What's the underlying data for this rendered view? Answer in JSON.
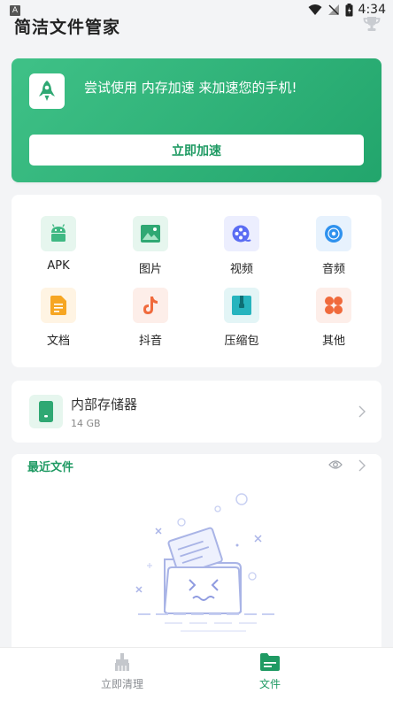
{
  "status_bar": {
    "notification_letter": "A",
    "time": "4:34"
  },
  "header": {
    "title": "简洁文件管家"
  },
  "promo": {
    "message": "尝试使用 内存加速 来加速您的手机!",
    "button_label": "立即加速"
  },
  "categories": [
    {
      "label": "APK",
      "icon": "android-icon",
      "bg": "#e6f6ee"
    },
    {
      "label": "图片",
      "icon": "image-icon",
      "bg": "#e6f6ee"
    },
    {
      "label": "视频",
      "icon": "video-icon",
      "bg": "#eceefe"
    },
    {
      "label": "音频",
      "icon": "audio-icon",
      "bg": "#e7f2fd"
    },
    {
      "label": "文档",
      "icon": "document-icon",
      "bg": "#fff4e3"
    },
    {
      "label": "抖音",
      "icon": "tiktok-icon",
      "bg": "#fdeee9"
    },
    {
      "label": "压缩包",
      "icon": "archive-icon",
      "bg": "#e3f5f6"
    },
    {
      "label": "其他",
      "icon": "other-icon",
      "bg": "#fdeee9"
    }
  ],
  "storage": {
    "name": "内部存储器",
    "size": "14 GB"
  },
  "recent": {
    "title": "最近文件"
  },
  "bottom_nav": [
    {
      "label": "立即清理",
      "icon": "broom-icon",
      "active": false
    },
    {
      "label": "文件",
      "icon": "folder-icon",
      "active": true
    }
  ],
  "colors": {
    "accent": "#1f9a63",
    "promo_start": "#3fc187",
    "promo_end": "#22a56c",
    "background": "#f3f4f6"
  }
}
